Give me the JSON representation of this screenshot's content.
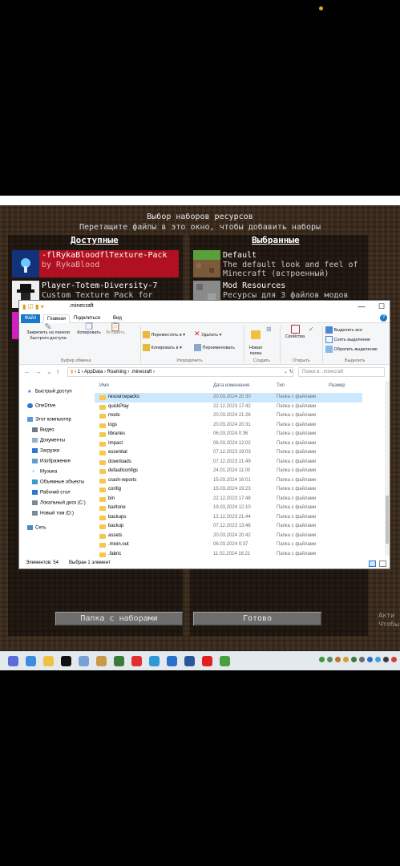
{
  "minecraft": {
    "title": "Выбор наборов ресурсов",
    "subtitle": "Перетащите файлы в это окно, чтобы добавить наборы",
    "available_header": "Доступные",
    "selected_header": "Выбранные",
    "available_packs": [
      {
        "name": "-flRykaBloodflTexture-Pack",
        "desc": "by RykaBlood",
        "selected": true
      },
      {
        "name": "Player-Totem-Diversity-7",
        "desc": "Custom Texture Pack for",
        "selected": false
      }
    ],
    "selected_packs": [
      {
        "name": "Default",
        "desc1": "The default look and feel of",
        "desc2": "Minecraft (встроенный)"
      },
      {
        "name": "Mod Resources",
        "desc1": "Ресурсы для 3 файлов модов",
        "desc2": ""
      }
    ],
    "btn_folder": "Папка с наборами",
    "btn_done": "Готово",
    "activate_line1": "Акти",
    "activate_line2": "Чтобы"
  },
  "explorer": {
    "path_title": ".minecraft",
    "tabs": [
      "Файл",
      "Главная",
      "Поделиться",
      "Вид"
    ],
    "ribbon": {
      "pin": "Закрепить на панели\nбыстрого доступа",
      "copy": "Копировать",
      "paste": "Вставить",
      "move_to": "Переместить в ▾",
      "copy_to": "Копировать в ▾",
      "delete": "Удалить ▾",
      "rename": "Переименовать",
      "new_folder": "Новая\nпапка",
      "properties": "Свойства",
      "select_all": "Выделить все",
      "select_none": "Снять выделение",
      "invert": "Обратить выделение",
      "group_clipboard": "Буфер обмена",
      "group_organize": "Упорядочить",
      "group_create": "Создать",
      "group_open": "Открыть",
      "group_select": "Выделить"
    },
    "address": "›  1  ›  AppData  ›  Roaming  ›  .minecraft  ›",
    "search_placeholder": "Поиск в: .minecraft",
    "nav": [
      "Быстрый доступ",
      "OneDrive",
      "Этот компьютер",
      "Видео",
      "Документы",
      "Загрузки",
      "Изображения",
      "Музыка",
      "Объемные объекты",
      "Рабочий стол",
      "Локальный диск (C:)",
      "Новый том (D:)",
      "Сеть"
    ],
    "columns": {
      "name": "Имя",
      "date": "Дата изменения",
      "type": "Тип",
      "size": "Размер"
    },
    "files": [
      {
        "name": "resourcepacks",
        "date": "20.03.2024 20:30",
        "type": "Папка с файлами"
      },
      {
        "name": "quickPlay",
        "date": "22.12.2023 17:42",
        "type": "Папка с файлами"
      },
      {
        "name": "mods",
        "date": "20.03.2024 21:26",
        "type": "Папка с файлами"
      },
      {
        "name": "logs",
        "date": "20.03.2024 20:31",
        "type": "Папка с файлами"
      },
      {
        "name": "libraries",
        "date": "06.03.2024 0:36",
        "type": "Папка с файлами"
      },
      {
        "name": "Impact",
        "date": "06.03.2024 12:02",
        "type": "Папка с файлами"
      },
      {
        "name": "essential",
        "date": "07.12.2023 19:03",
        "type": "Папка с файлами"
      },
      {
        "name": "downloads",
        "date": "07.12.2023 21:49",
        "type": "Папка с файлами"
      },
      {
        "name": "defaultconfigs",
        "date": "24.01.2024 11:00",
        "type": "Папка с файлами"
      },
      {
        "name": "crash-reports",
        "date": "15.03.2024 16:01",
        "type": "Папка с файлами"
      },
      {
        "name": "config",
        "date": "15.03.2024 19:23",
        "type": "Папка с файлами"
      },
      {
        "name": "bin",
        "date": "22.12.2023 17:48",
        "type": "Папка с файлами"
      },
      {
        "name": "baritone",
        "date": "19.03.2024 12:10",
        "type": "Папка с файлами"
      },
      {
        "name": "backups",
        "date": "12.12.2023 21:44",
        "type": "Папка с файлами"
      },
      {
        "name": "backup",
        "date": "07.12.2023 13:46",
        "type": "Папка с файлами"
      },
      {
        "name": "assets",
        "date": "20.03.2024 20:42",
        "type": "Папка с файлами"
      },
      {
        "name": ".mixin.out",
        "date": "06.03.2024 0:37",
        "type": "Папка с файлами"
      },
      {
        "name": ".fabric",
        "date": "11.02.2024 16:21",
        "type": "Папка с файлами"
      }
    ],
    "status_count": "Элементов: 54",
    "status_selected": "Выбран 1 элемент"
  },
  "taskbar_apps": [
    "Chrome",
    "Explorer",
    "Folder",
    "TikTok",
    "Cloud",
    "Notes",
    "Minecraft",
    "Yandex",
    "Edge",
    "Mail",
    "Word",
    "Opera",
    "Game"
  ],
  "taskbar_app_colors": [
    "#5b6cd8",
    "#3c8de0",
    "#f0c040",
    "#111111",
    "#7aa0d8",
    "#c89a4a",
    "#3a7a3a",
    "#e03030",
    "#2a9ad8",
    "#2a70c8",
    "#2b579a",
    "#e02020",
    "#4aa040"
  ]
}
